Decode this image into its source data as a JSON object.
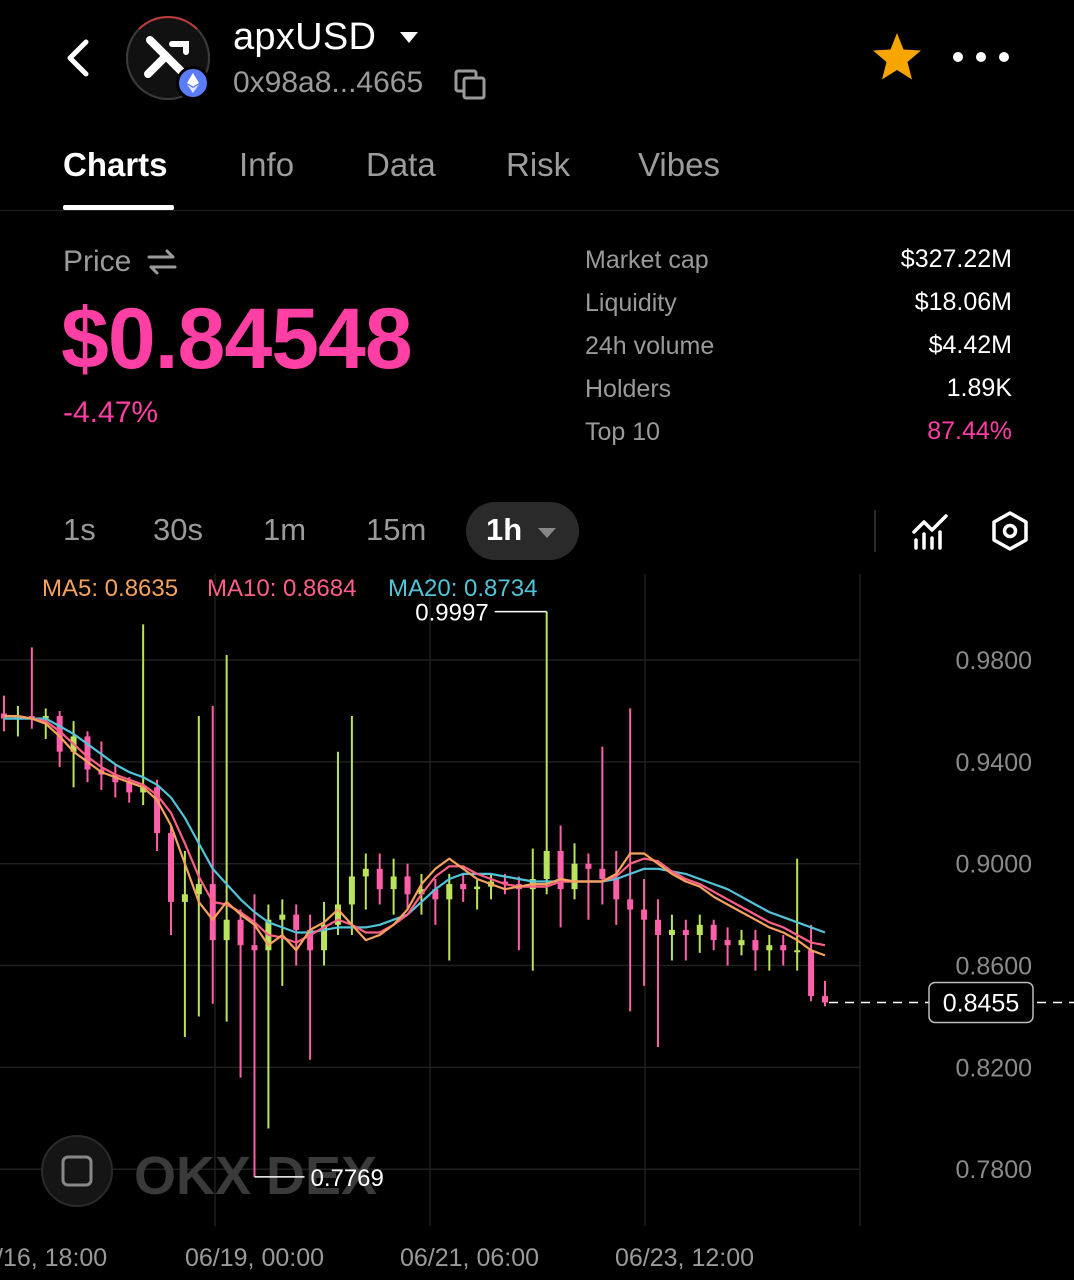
{
  "header": {
    "back_icon": "chevron-left-icon",
    "token_name": "apxUSD",
    "token_address": "0x98a8...4665",
    "logo_icon": "apx-token-logo",
    "network_icon": "ethereum-icon",
    "copy_icon": "copy-icon",
    "favorite_icon": "star-icon",
    "more_icon": "more-horizontal-icon",
    "favorite_color": "#f7a600"
  },
  "tabs": [
    {
      "label": "Charts",
      "active": true
    },
    {
      "label": "Info",
      "active": false
    },
    {
      "label": "Data",
      "active": false
    },
    {
      "label": "Risk",
      "active": false
    },
    {
      "label": "Vibes",
      "active": false
    }
  ],
  "price": {
    "label": "Price",
    "value": "$0.84548",
    "change": "-4.47%",
    "color": "#ff3fa4"
  },
  "stats": [
    {
      "label": "Market cap",
      "value": "$327.22M"
    },
    {
      "label": "Liquidity",
      "value": "$18.06M"
    },
    {
      "label": "24h volume",
      "value": "$4.42M"
    },
    {
      "label": "Holders",
      "value": "1.89K"
    },
    {
      "label": "Top 10",
      "value": "87.44%"
    }
  ],
  "intervals": {
    "options": [
      "1s",
      "30s",
      "1m",
      "15m"
    ],
    "selected": "1h"
  },
  "moving_averages": [
    {
      "label": "MA5: 0.8635",
      "color": "#f5a25d"
    },
    {
      "label": "MA10: 0.8684",
      "color": "#ff5f87"
    },
    {
      "label": "MA20: 0.8734",
      "color": "#52c4d9"
    }
  ],
  "chart_data": {
    "type": "candlestick",
    "y_ticks": [
      "0.9800",
      "0.9400",
      "0.9000",
      "0.8600",
      "0.8200",
      "0.7800"
    ],
    "x_ticks": [
      "/16, 18:00",
      "06/19, 00:00",
      "06/21, 06:00",
      "06/23, 12:00"
    ],
    "high_label": "0.9997",
    "low_label": "0.7769",
    "current_price_label": "0.8455",
    "ylim": [
      0.7577,
      1.0138
    ],
    "up_color": "#b8e35a",
    "down_color": "#ff5fa8",
    "watermark": "OKX DEX",
    "ma5": [
      0.958,
      0.958,
      0.957,
      0.955,
      0.95,
      0.944,
      0.94,
      0.936,
      0.934,
      0.932,
      0.93,
      0.925,
      0.915,
      0.9,
      0.885,
      0.878,
      0.885,
      0.88,
      0.876,
      0.868,
      0.872,
      0.866,
      0.874,
      0.877,
      0.882,
      0.876,
      0.87,
      0.872,
      0.876,
      0.882,
      0.892,
      0.898,
      0.902,
      0.898,
      0.894,
      0.892,
      0.89,
      0.891,
      0.892,
      0.892,
      0.894,
      0.893,
      0.893,
      0.893,
      0.896,
      0.904,
      0.904,
      0.9,
      0.896,
      0.893,
      0.891,
      0.887,
      0.884,
      0.881,
      0.878,
      0.875,
      0.873,
      0.87,
      0.866,
      0.864
    ],
    "ma10": [
      0.958,
      0.958,
      0.957,
      0.956,
      0.952,
      0.947,
      0.942,
      0.938,
      0.935,
      0.933,
      0.931,
      0.927,
      0.92,
      0.908,
      0.895,
      0.885,
      0.884,
      0.881,
      0.877,
      0.872,
      0.871,
      0.869,
      0.872,
      0.875,
      0.878,
      0.876,
      0.873,
      0.873,
      0.876,
      0.88,
      0.888,
      0.895,
      0.899,
      0.899,
      0.896,
      0.894,
      0.892,
      0.891,
      0.891,
      0.891,
      0.893,
      0.893,
      0.893,
      0.893,
      0.895,
      0.9,
      0.902,
      0.901,
      0.897,
      0.894,
      0.892,
      0.889,
      0.886,
      0.883,
      0.88,
      0.877,
      0.875,
      0.872,
      0.869,
      0.868
    ],
    "ma20": [
      0.957,
      0.957,
      0.957,
      0.957,
      0.954,
      0.951,
      0.947,
      0.943,
      0.939,
      0.936,
      0.934,
      0.931,
      0.926,
      0.918,
      0.908,
      0.898,
      0.892,
      0.886,
      0.881,
      0.877,
      0.875,
      0.873,
      0.873,
      0.874,
      0.875,
      0.875,
      0.875,
      0.876,
      0.878,
      0.88,
      0.885,
      0.89,
      0.894,
      0.896,
      0.896,
      0.896,
      0.895,
      0.894,
      0.893,
      0.893,
      0.893,
      0.893,
      0.893,
      0.893,
      0.894,
      0.896,
      0.898,
      0.898,
      0.897,
      0.896,
      0.894,
      0.892,
      0.89,
      0.887,
      0.884,
      0.881,
      0.879,
      0.877,
      0.875,
      0.873
    ],
    "candles": [
      {
        "o": 0.959,
        "h": 0.966,
        "l": 0.952,
        "c": 0.957
      },
      {
        "o": 0.957,
        "h": 0.962,
        "l": 0.95,
        "c": 0.958
      },
      {
        "o": 0.958,
        "h": 0.985,
        "l": 0.953,
        "c": 0.957
      },
      {
        "o": 0.957,
        "h": 0.961,
        "l": 0.949,
        "c": 0.958
      },
      {
        "o": 0.958,
        "h": 0.96,
        "l": 0.938,
        "c": 0.944
      },
      {
        "o": 0.944,
        "h": 0.956,
        "l": 0.93,
        "c": 0.95
      },
      {
        "o": 0.95,
        "h": 0.952,
        "l": 0.932,
        "c": 0.937
      },
      {
        "o": 0.937,
        "h": 0.948,
        "l": 0.929,
        "c": 0.935
      },
      {
        "o": 0.935,
        "h": 0.939,
        "l": 0.926,
        "c": 0.932
      },
      {
        "o": 0.932,
        "h": 0.934,
        "l": 0.924,
        "c": 0.928
      },
      {
        "o": 0.928,
        "h": 0.994,
        "l": 0.923,
        "c": 0.93
      },
      {
        "o": 0.93,
        "h": 0.933,
        "l": 0.905,
        "c": 0.912
      },
      {
        "o": 0.912,
        "h": 0.915,
        "l": 0.872,
        "c": 0.885
      },
      {
        "o": 0.885,
        "h": 0.905,
        "l": 0.832,
        "c": 0.888
      },
      {
        "o": 0.888,
        "h": 0.958,
        "l": 0.84,
        "c": 0.892
      },
      {
        "o": 0.892,
        "h": 0.962,
        "l": 0.845,
        "c": 0.87
      },
      {
        "o": 0.87,
        "h": 0.982,
        "l": 0.838,
        "c": 0.878
      },
      {
        "o": 0.878,
        "h": 0.882,
        "l": 0.816,
        "c": 0.868
      },
      {
        "o": 0.868,
        "h": 0.888,
        "l": 0.777,
        "c": 0.866
      },
      {
        "o": 0.866,
        "h": 0.884,
        "l": 0.796,
        "c": 0.878
      },
      {
        "o": 0.878,
        "h": 0.886,
        "l": 0.852,
        "c": 0.88
      },
      {
        "o": 0.88,
        "h": 0.884,
        "l": 0.86,
        "c": 0.874
      },
      {
        "o": 0.874,
        "h": 0.88,
        "l": 0.823,
        "c": 0.866
      },
      {
        "o": 0.866,
        "h": 0.885,
        "l": 0.86,
        "c": 0.876
      },
      {
        "o": 0.876,
        "h": 0.944,
        "l": 0.872,
        "c": 0.884
      },
      {
        "o": 0.884,
        "h": 0.958,
        "l": 0.872,
        "c": 0.895
      },
      {
        "o": 0.895,
        "h": 0.904,
        "l": 0.882,
        "c": 0.898
      },
      {
        "o": 0.898,
        "h": 0.904,
        "l": 0.884,
        "c": 0.89
      },
      {
        "o": 0.89,
        "h": 0.902,
        "l": 0.88,
        "c": 0.895
      },
      {
        "o": 0.895,
        "h": 0.9,
        "l": 0.882,
        "c": 0.888
      },
      {
        "o": 0.888,
        "h": 0.896,
        "l": 0.88,
        "c": 0.89
      },
      {
        "o": 0.89,
        "h": 0.894,
        "l": 0.876,
        "c": 0.886
      },
      {
        "o": 0.886,
        "h": 0.896,
        "l": 0.862,
        "c": 0.892
      },
      {
        "o": 0.892,
        "h": 0.896,
        "l": 0.885,
        "c": 0.89
      },
      {
        "o": 0.89,
        "h": 0.894,
        "l": 0.882,
        "c": 0.891
      },
      {
        "o": 0.891,
        "h": 0.896,
        "l": 0.886,
        "c": 0.893
      },
      {
        "o": 0.893,
        "h": 0.896,
        "l": 0.888,
        "c": 0.892
      },
      {
        "o": 0.892,
        "h": 0.895,
        "l": 0.866,
        "c": 0.89
      },
      {
        "o": 0.89,
        "h": 0.906,
        "l": 0.858,
        "c": 0.894
      },
      {
        "o": 0.894,
        "h": 0.999,
        "l": 0.888,
        "c": 0.905
      },
      {
        "o": 0.905,
        "h": 0.915,
        "l": 0.875,
        "c": 0.89
      },
      {
        "o": 0.89,
        "h": 0.908,
        "l": 0.886,
        "c": 0.9
      },
      {
        "o": 0.9,
        "h": 0.904,
        "l": 0.878,
        "c": 0.898
      },
      {
        "o": 0.898,
        "h": 0.946,
        "l": 0.884,
        "c": 0.894
      },
      {
        "o": 0.894,
        "h": 0.905,
        "l": 0.876,
        "c": 0.886
      },
      {
        "o": 0.886,
        "h": 0.961,
        "l": 0.842,
        "c": 0.882
      },
      {
        "o": 0.882,
        "h": 0.894,
        "l": 0.852,
        "c": 0.878
      },
      {
        "o": 0.878,
        "h": 0.886,
        "l": 0.828,
        "c": 0.872
      },
      {
        "o": 0.872,
        "h": 0.88,
        "l": 0.862,
        "c": 0.874
      },
      {
        "o": 0.874,
        "h": 0.878,
        "l": 0.862,
        "c": 0.872
      },
      {
        "o": 0.872,
        "h": 0.88,
        "l": 0.865,
        "c": 0.876
      },
      {
        "o": 0.876,
        "h": 0.878,
        "l": 0.866,
        "c": 0.87
      },
      {
        "o": 0.87,
        "h": 0.875,
        "l": 0.86,
        "c": 0.868
      },
      {
        "o": 0.868,
        "h": 0.874,
        "l": 0.864,
        "c": 0.87
      },
      {
        "o": 0.87,
        "h": 0.874,
        "l": 0.858,
        "c": 0.866
      },
      {
        "o": 0.866,
        "h": 0.872,
        "l": 0.858,
        "c": 0.868
      },
      {
        "o": 0.868,
        "h": 0.872,
        "l": 0.86,
        "c": 0.866
      },
      {
        "o": 0.866,
        "h": 0.902,
        "l": 0.858,
        "c": 0.866
      },
      {
        "o": 0.866,
        "h": 0.876,
        "l": 0.846,
        "c": 0.848
      },
      {
        "o": 0.848,
        "h": 0.854,
        "l": 0.844,
        "c": 0.8455
      }
    ]
  }
}
